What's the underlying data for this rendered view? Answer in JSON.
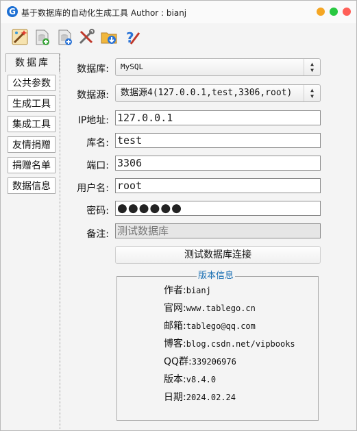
{
  "window": {
    "title": "基于数据库的自动化生成工具  Author : bianj",
    "app_icon": "G",
    "controls": {
      "minimize_color": "#f5a623",
      "maximize_color": "#28c840",
      "close_color": "#ff5f57"
    }
  },
  "toolbar": {
    "icons": [
      "wizard-icon",
      "add-database-icon",
      "new-database-icon",
      "tools-icon",
      "folder-download-icon",
      "help-icon"
    ]
  },
  "sidebar": {
    "items": [
      {
        "label": "数据库",
        "active": true
      },
      {
        "label": "公共参数"
      },
      {
        "label": "生成工具"
      },
      {
        "label": "集成工具"
      },
      {
        "label": "友情捐赠"
      },
      {
        "label": "捐赠名单"
      },
      {
        "label": "数据信息"
      }
    ]
  },
  "form": {
    "db_type": {
      "label": "数据库:",
      "value": "MySQL"
    },
    "datasource": {
      "label": "数据源:",
      "value": "数据源4(127.0.0.1,test,3306,root)"
    },
    "ip": {
      "label": "IP地址:",
      "value": "127.0.0.1"
    },
    "dbname": {
      "label": "库名:",
      "value": "test"
    },
    "port": {
      "label": "端口:",
      "value": "3306"
    },
    "username": {
      "label": "用户名:",
      "value": "root"
    },
    "password": {
      "label": "密码:",
      "value": "●●●●●●"
    },
    "remark": {
      "label": "备注:",
      "value": "测试数据库"
    },
    "test_button": "测试数据库连接"
  },
  "version_info": {
    "title": "版本信息",
    "rows": [
      {
        "label": "作者:",
        "value": "bianj"
      },
      {
        "label": "官网:",
        "value": "www.tablego.cn"
      },
      {
        "label": "邮箱:",
        "value": "tablego@qq.com"
      },
      {
        "label": "博客:",
        "value": "blog.csdn.net/vipbooks"
      },
      {
        "label": "QQ群:",
        "value": "339206976"
      },
      {
        "label": "版本:",
        "value": "v8.4.0"
      },
      {
        "label": "日期:",
        "value": "2024.02.24"
      }
    ]
  }
}
